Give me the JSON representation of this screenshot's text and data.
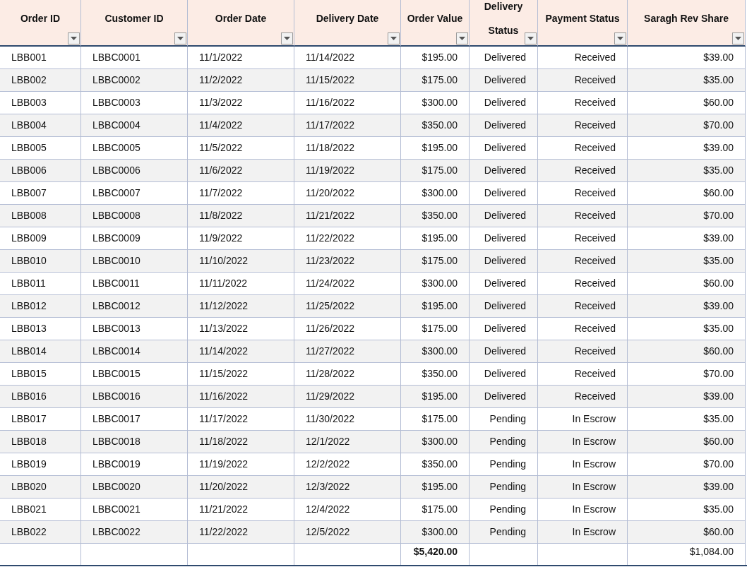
{
  "table": {
    "columns": [
      "Order ID",
      "Customer ID",
      "Order Date",
      "Delivery Date",
      "Order Value",
      "Delivery Status",
      "Payment Status",
      "Saragh Rev Share"
    ],
    "rows": [
      [
        "LBB001",
        "LBBC0001",
        "11/1/2022",
        "11/14/2022",
        "$195.00",
        "Delivered",
        "Received",
        "$39.00"
      ],
      [
        "LBB002",
        "LBBC0002",
        "11/2/2022",
        "11/15/2022",
        "$175.00",
        "Delivered",
        "Received",
        "$35.00"
      ],
      [
        "LBB003",
        "LBBC0003",
        "11/3/2022",
        "11/16/2022",
        "$300.00",
        "Delivered",
        "Received",
        "$60.00"
      ],
      [
        "LBB004",
        "LBBC0004",
        "11/4/2022",
        "11/17/2022",
        "$350.00",
        "Delivered",
        "Received",
        "$70.00"
      ],
      [
        "LBB005",
        "LBBC0005",
        "11/5/2022",
        "11/18/2022",
        "$195.00",
        "Delivered",
        "Received",
        "$39.00"
      ],
      [
        "LBB006",
        "LBBC0006",
        "11/6/2022",
        "11/19/2022",
        "$175.00",
        "Delivered",
        "Received",
        "$35.00"
      ],
      [
        "LBB007",
        "LBBC0007",
        "11/7/2022",
        "11/20/2022",
        "$300.00",
        "Delivered",
        "Received",
        "$60.00"
      ],
      [
        "LBB008",
        "LBBC0008",
        "11/8/2022",
        "11/21/2022",
        "$350.00",
        "Delivered",
        "Received",
        "$70.00"
      ],
      [
        "LBB009",
        "LBBC0009",
        "11/9/2022",
        "11/22/2022",
        "$195.00",
        "Delivered",
        "Received",
        "$39.00"
      ],
      [
        "LBB010",
        "LBBC0010",
        "11/10/2022",
        "11/23/2022",
        "$175.00",
        "Delivered",
        "Received",
        "$35.00"
      ],
      [
        "LBB011",
        "LBBC0011",
        "11/11/2022",
        "11/24/2022",
        "$300.00",
        "Delivered",
        "Received",
        "$60.00"
      ],
      [
        "LBB012",
        "LBBC0012",
        "11/12/2022",
        "11/25/2022",
        "$195.00",
        "Delivered",
        "Received",
        "$39.00"
      ],
      [
        "LBB013",
        "LBBC0013",
        "11/13/2022",
        "11/26/2022",
        "$175.00",
        "Delivered",
        "Received",
        "$35.00"
      ],
      [
        "LBB014",
        "LBBC0014",
        "11/14/2022",
        "11/27/2022",
        "$300.00",
        "Delivered",
        "Received",
        "$60.00"
      ],
      [
        "LBB015",
        "LBBC0015",
        "11/15/2022",
        "11/28/2022",
        "$350.00",
        "Delivered",
        "Received",
        "$70.00"
      ],
      [
        "LBB016",
        "LBBC0016",
        "11/16/2022",
        "11/29/2022",
        "$195.00",
        "Delivered",
        "Received",
        "$39.00"
      ],
      [
        "LBB017",
        "LBBC0017",
        "11/17/2022",
        "11/30/2022",
        "$175.00",
        "Pending",
        "In Escrow",
        "$35.00"
      ],
      [
        "LBB018",
        "LBBC0018",
        "11/18/2022",
        "12/1/2022",
        "$300.00",
        "Pending",
        "In Escrow",
        "$60.00"
      ],
      [
        "LBB019",
        "LBBC0019",
        "11/19/2022",
        "12/2/2022",
        "$350.00",
        "Pending",
        "In Escrow",
        "$70.00"
      ],
      [
        "LBB020",
        "LBBC0020",
        "11/20/2022",
        "12/3/2022",
        "$195.00",
        "Pending",
        "In Escrow",
        "$39.00"
      ],
      [
        "LBB021",
        "LBBC0021",
        "11/21/2022",
        "12/4/2022",
        "$175.00",
        "Pending",
        "In Escrow",
        "$35.00"
      ],
      [
        "LBB022",
        "LBBC0022",
        "11/22/2022",
        "12/5/2022",
        "$300.00",
        "Pending",
        "In Escrow",
        "$60.00"
      ]
    ],
    "totals": {
      "order_value": "$5,420.00",
      "saragh_rev_share": "$1,084.00"
    }
  }
}
